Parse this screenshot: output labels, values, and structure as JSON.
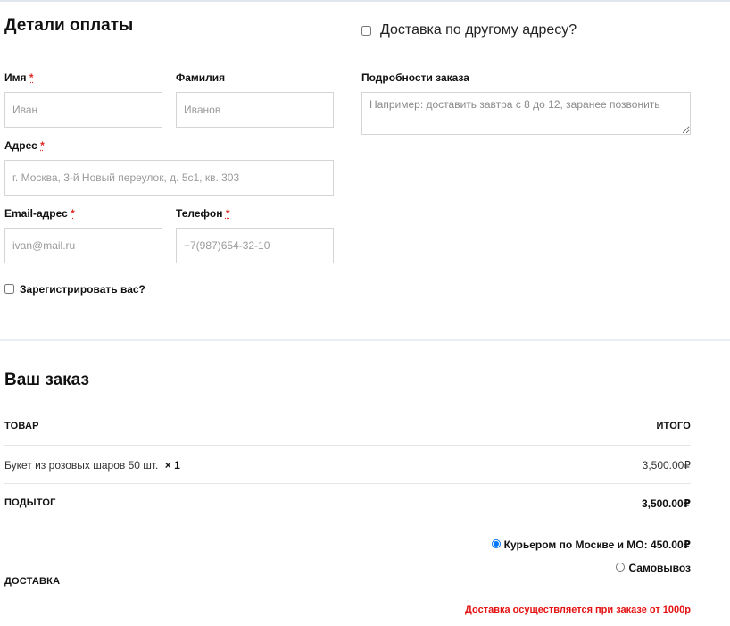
{
  "billing": {
    "title": "Детали оплаты",
    "required_mark": "*",
    "first_name": {
      "label": "Имя",
      "placeholder": "Иван"
    },
    "last_name": {
      "label": "Фамилия",
      "placeholder": "Иванов"
    },
    "address": {
      "label": "Адрес",
      "placeholder": "г. Москва, 3-й Новый переулок, д. 5с1, кв. 303"
    },
    "email": {
      "label": "Email-адрес",
      "placeholder": "ivan@mail.ru"
    },
    "phone": {
      "label": "Телефон",
      "placeholder": "+7(987)654-32-10"
    },
    "register_label": "Зарегистрировать вас?"
  },
  "shipping": {
    "different_address_label": "Доставка по другому адресу?",
    "notes_label": "Подробности заказа",
    "notes_placeholder": "Например: доставить завтра с 8 до 12, заранее позвонить"
  },
  "order": {
    "title": "Ваш заказ",
    "col_product": "ТОВАР",
    "col_total": "ИТОГО",
    "item": {
      "name": "Букет из розовых шаров 50 шт.",
      "qty": "× 1",
      "total": "3,500.00₽"
    },
    "subtotal_label": "ПОДЫТОГ",
    "subtotal_value": "3,500.00₽",
    "shipping_label": "ДОСТАВКА",
    "shipping_options": [
      {
        "label": "Курьером по Москве и МО: 450.00₽",
        "selected": true
      },
      {
        "label": "Самовывоз",
        "selected": false
      }
    ],
    "shipping_note": "Доставка осуществляется при заказе от 1000р"
  },
  "colors": {
    "accent_red": "#e41212",
    "required": "#e02b27",
    "border": "#d5d5d5"
  }
}
